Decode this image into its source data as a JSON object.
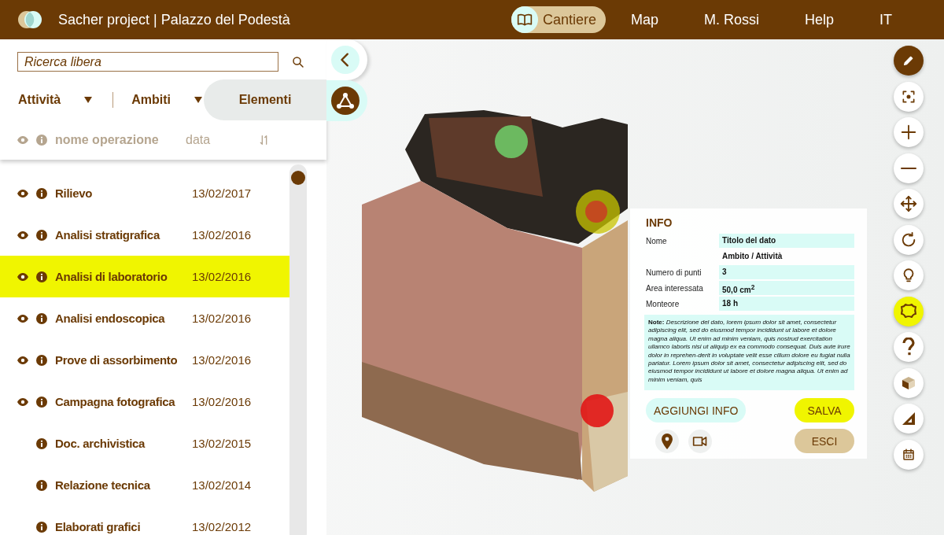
{
  "header": {
    "title": "Sacher project | Palazzo del Podestà",
    "nav": [
      {
        "label": "Cantiere",
        "selected": true,
        "kind": "book"
      },
      {
        "label": "Map",
        "selected": false
      },
      {
        "label": "M. Rossi",
        "selected": false
      },
      {
        "label": "Help",
        "selected": false
      },
      {
        "label": "IT",
        "selected": false
      }
    ]
  },
  "search": {
    "placeholder": "Ricerca libera"
  },
  "filters": [
    {
      "label": "Attività"
    },
    {
      "label": "Ambiti"
    }
  ],
  "elements_tab": {
    "label": "Elementi"
  },
  "list": {
    "columns": [
      {
        "label": "nome operazione"
      },
      {
        "label": "data"
      }
    ],
    "rows": [
      {
        "name": "Rilievo",
        "date": "13/02/2017",
        "visible": true,
        "selected": false
      },
      {
        "name": "Analisi stratigrafica",
        "date": "13/02/2016",
        "visible": true,
        "selected": false
      },
      {
        "name": "Analisi di laboratorio",
        "date": "13/02/2016",
        "visible": true,
        "selected": true
      },
      {
        "name": "Analisi endoscopica",
        "date": "13/02/2016",
        "visible": true,
        "selected": false
      },
      {
        "name": "Prove di assorbimento",
        "date": "13/02/2016",
        "visible": true,
        "selected": false
      },
      {
        "name": "Campagna fotografica",
        "date": "13/02/2016",
        "visible": true,
        "selected": false
      },
      {
        "name": "Doc. archivistica",
        "date": "13/02/2015",
        "visible": false,
        "selected": false
      },
      {
        "name": "Relazione tecnica",
        "date": "13/02/2014",
        "visible": false,
        "selected": false
      },
      {
        "name": "Elaborati grafici",
        "date": "13/02/2012",
        "visible": false,
        "selected": false
      }
    ]
  },
  "info": {
    "title": "INFO",
    "fields": [
      {
        "kind": "field",
        "label": "Nome",
        "value": "Titolo del dato"
      },
      {
        "kind": "subtitle",
        "value": "Ambito / Attività"
      },
      {
        "kind": "field",
        "label": "Numero di punti",
        "value": "3"
      },
      {
        "kind": "field",
        "label": "Area interessata",
        "value": "50,0  cm$^{2}$"
      },
      {
        "kind": "field",
        "label": "Monteore",
        "value": "18 h"
      }
    ],
    "note": "**Note:** *Descrizione del dato, lorem ipsum dolor sit amet, consectetur adipiscing elit, sed do eiusmod tempor incididunt ut labore et dolore magna aliqua. Ut enim ad minim veniam, quis nostrud exercitation ullamco laboris nisi ut aliquip ex ea commodo consequat. Duis aute irure dolor in reprehen-derit in voluptate velit esse cillum dolore eu fugiat nulla pariatur. Lorem ipsum dolor sit amet, consectetur adipiscing elit, sed do eiusmod tempor incididunt ut labore et dolore magna aliqua. Ut enim ad minim veniam, quis*",
    "buttons": [
      {
        "label": "AGGIUNGI INFO",
        "kind": "secondary"
      },
      {
        "label": "SALVA",
        "kind": "primary"
      },
      {
        "label": "ESCI",
        "kind": "cancel"
      }
    ]
  },
  "tools": [
    {
      "kind": "pencil",
      "on": true,
      "selected": false
    },
    {
      "kind": "focus",
      "on": false,
      "selected": false
    },
    {
      "kind": "plus",
      "on": false,
      "selected": false
    },
    {
      "kind": "minus",
      "on": false,
      "selected": false
    },
    {
      "kind": "move",
      "on": false,
      "selected": false
    },
    {
      "kind": "rotate",
      "on": false,
      "selected": false
    },
    {
      "kind": "bulb",
      "on": false,
      "selected": false
    },
    {
      "kind": "shape",
      "on": false,
      "selected": true
    },
    {
      "kind": "help",
      "on": false,
      "selected": false
    },
    {
      "kind": "cube",
      "on": false,
      "selected": false
    },
    {
      "kind": "ruler",
      "on": false,
      "selected": false
    },
    {
      "kind": "calendar",
      "on": false,
      "selected": false
    }
  ]
}
